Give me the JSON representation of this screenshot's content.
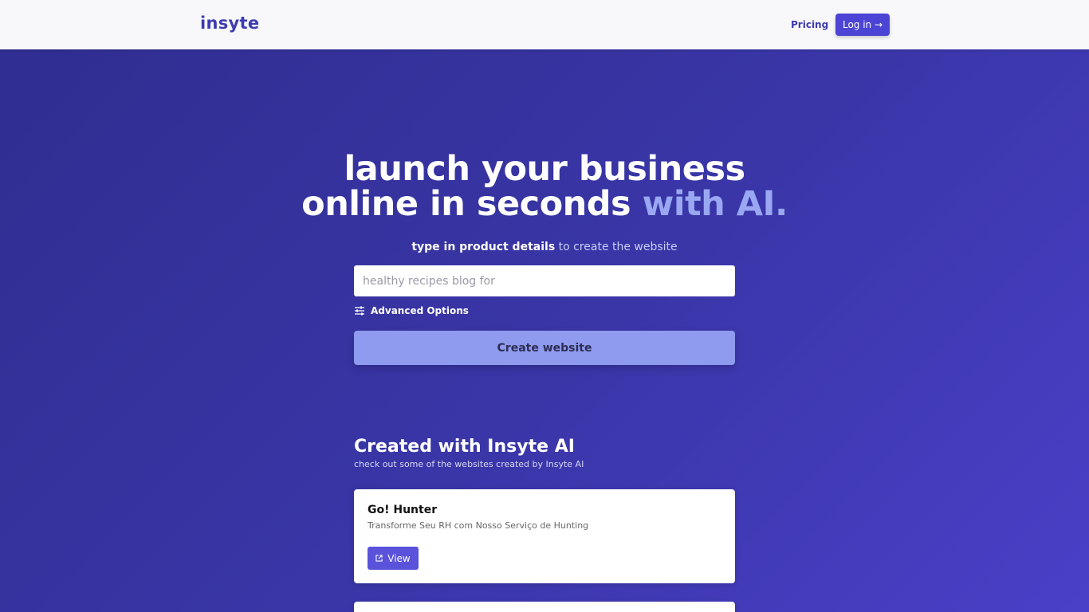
{
  "navbar": {
    "logo": "insyte",
    "pricing_label": "Pricing",
    "login_label": "Log in →"
  },
  "hero": {
    "title_line1": "launch your business",
    "title_line2": "online in seconds",
    "title_accent": "with AI.",
    "subtitle_bold": "type in product details",
    "subtitle_rest": " to create the website",
    "input_placeholder": "healthy recipes blog for",
    "advanced_options_label": "Advanced Options",
    "create_button_label": "Create website"
  },
  "showcase": {
    "title": "Created with Insyte AI",
    "subtitle": "check out some of the websites created by Insyte AI",
    "cards": [
      {
        "name": "Go! Hunter",
        "description": "Transforme Seu RH com Nosso Serviço de Hunting",
        "view_label": "View"
      }
    ]
  },
  "colors": {
    "brand": "#3d3bb0",
    "accent": "#9aa7f2",
    "button": "#4b44d4"
  }
}
